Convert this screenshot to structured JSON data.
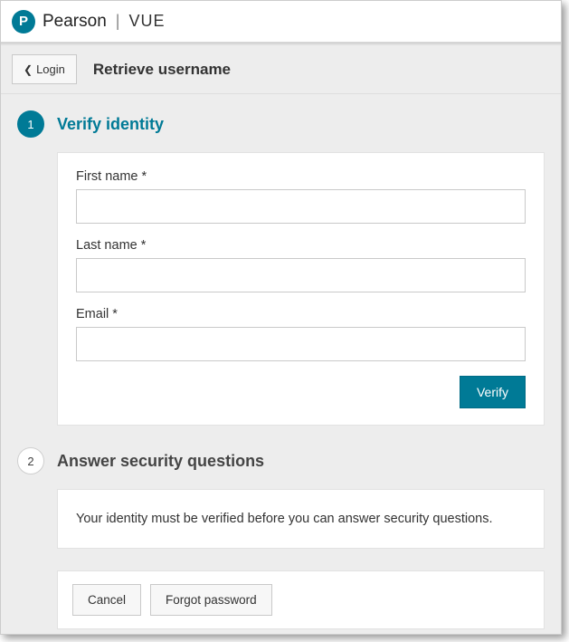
{
  "brand": {
    "name": "Pearson",
    "sub": "VUE"
  },
  "nav": {
    "back_label": "Login",
    "page_title": "Retrieve username"
  },
  "steps": {
    "s1": {
      "num": "1",
      "title": "Verify identity"
    },
    "s2": {
      "num": "2",
      "title": "Answer security questions"
    }
  },
  "form": {
    "first_name": {
      "label": "First name *",
      "value": ""
    },
    "last_name": {
      "label": "Last name *",
      "value": ""
    },
    "email": {
      "label": "Email *",
      "value": ""
    },
    "verify_label": "Verify"
  },
  "note": "Your identity must be verified before you can answer security questions.",
  "actions": {
    "cancel": "Cancel",
    "forgot": "Forgot password"
  }
}
